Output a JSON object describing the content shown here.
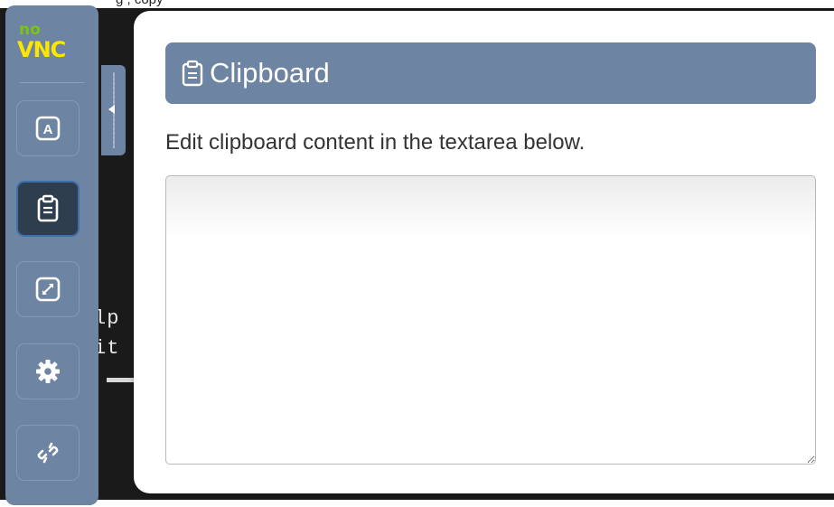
{
  "browser_strip": {
    "partial_text": "g                                   , copy"
  },
  "terminal": {
    "lines": [
      "lp",
      "it"
    ]
  },
  "control_bar": {
    "logo": {
      "top": "no",
      "bottom": "VNC"
    },
    "buttons": [
      {
        "name": "extra-keys",
        "icon": "keyboard-a-icon"
      },
      {
        "name": "clipboard",
        "icon": "clipboard-icon",
        "active": true
      },
      {
        "name": "fullscreen",
        "icon": "fullscreen-icon"
      },
      {
        "name": "settings",
        "icon": "gear-icon"
      },
      {
        "name": "disconnect",
        "icon": "broken-link-icon"
      }
    ]
  },
  "clipboard_panel": {
    "title": "Clipboard",
    "description": "Edit clipboard content in the textarea below.",
    "textarea_value": ""
  },
  "colors": {
    "control_bar": "#6e84a3",
    "active_button": "#2f3e4f",
    "logo_no": "#7cc414",
    "logo_vnc": "#ffe600"
  }
}
